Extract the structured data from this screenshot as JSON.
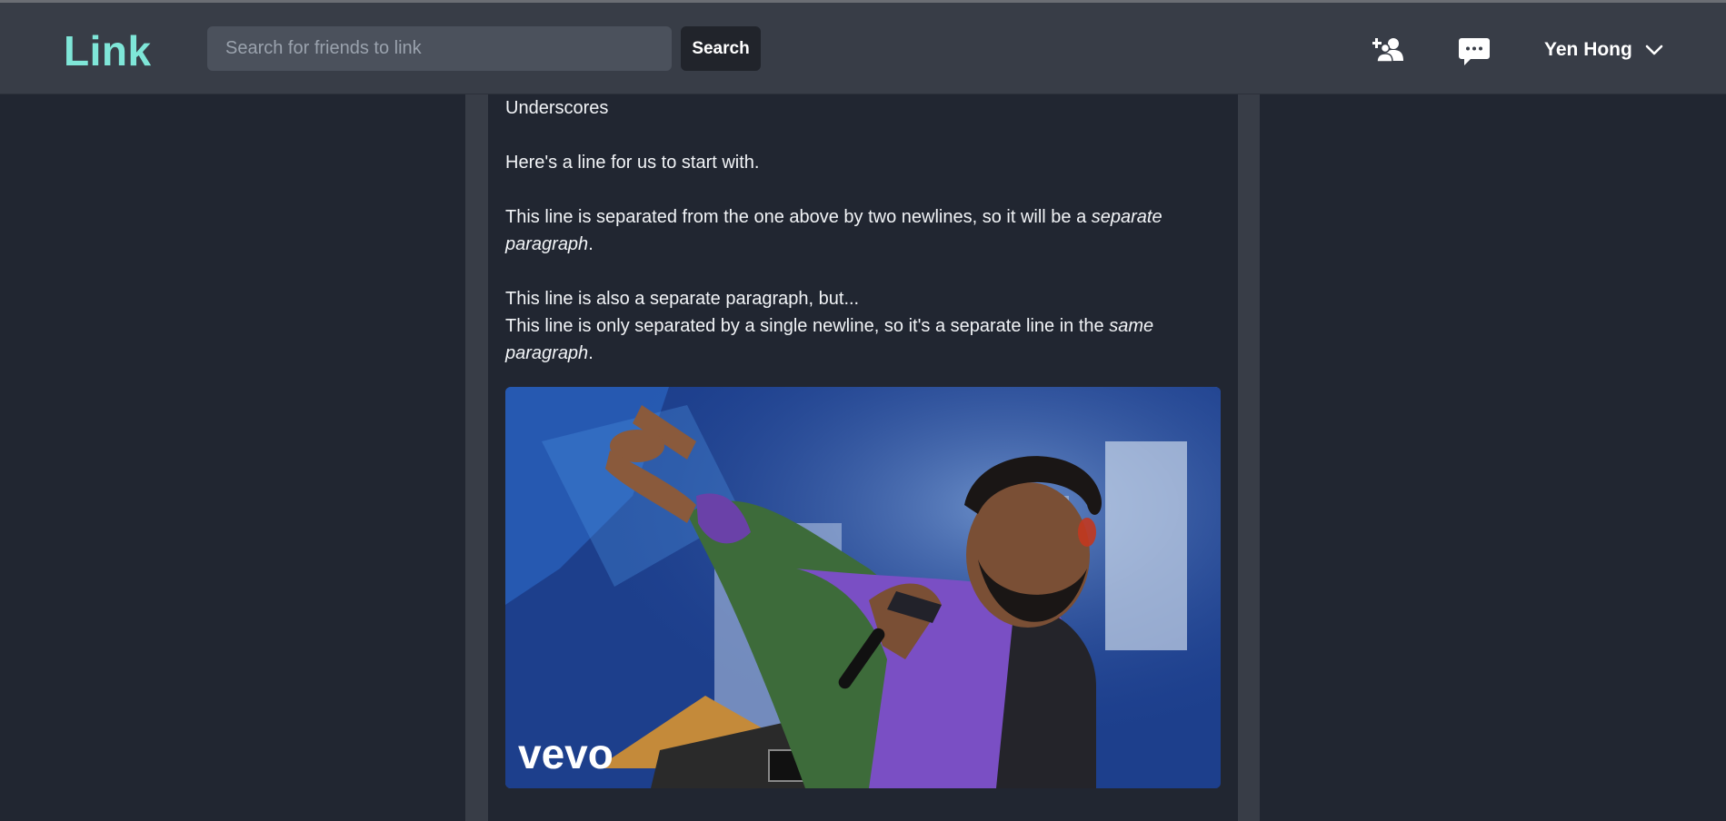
{
  "app": {
    "logo": "Link",
    "brand_color": "#7fe6d8"
  },
  "search": {
    "placeholder": "Search for friends to link",
    "value": "",
    "button_label": "Search"
  },
  "nav": {
    "icons": [
      "add-friend-icon",
      "chat-icon"
    ],
    "user_name": "Yen Hong",
    "user_menu_icon": "chevron-down-icon"
  },
  "post": {
    "heading_line": "Underscores",
    "paragraph1": "Here's a line for us to start with.",
    "paragraph2_text": "This line is separated from the one above by two newlines, so it will be a ",
    "paragraph2_em": "separate paragraph",
    "paragraph2_end": ".",
    "paragraph3_line1": "This line is also a separate paragraph, but...",
    "paragraph3_line2_text": "This line is only separated by a single newline, so it's a separate line in the ",
    "paragraph3_line2_em": "same paragraph",
    "paragraph3_line2_end": ".",
    "video_watermark": "vevo"
  }
}
